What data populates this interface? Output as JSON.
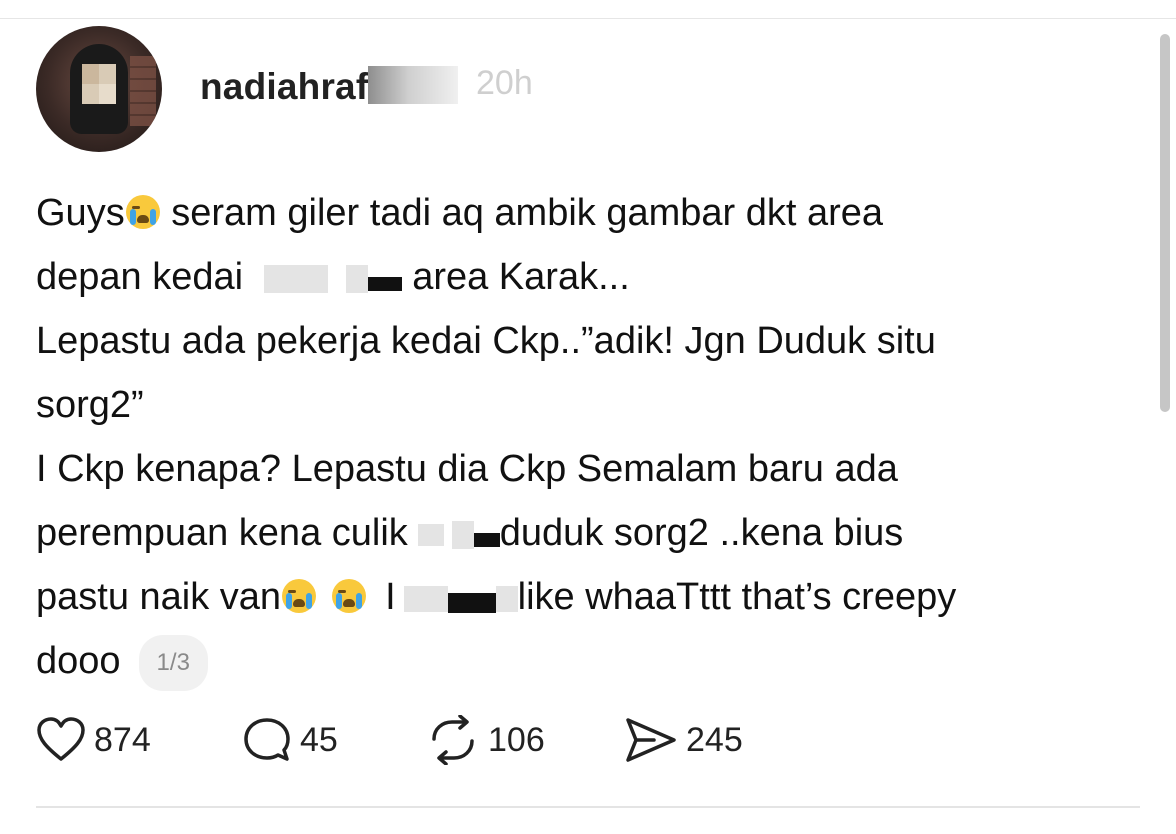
{
  "post": {
    "username_visible": "nadiahrafi",
    "timestamp_visible": "20h",
    "lines": {
      "l1a": "Guys",
      "l1b": " seram giler tadi aq ambik gambar dkt area",
      "l2a": "depan kedai ",
      "l2b": " area Karak...",
      "l3": "Lepastu ada pekerja kedai Ckp..”adik! Jgn Duduk situ",
      "l4": "sorg2”",
      "l5": "I Ckp kenapa? Lepastu dia Ckp Semalam baru ada",
      "l6a": "perempuan kena culik",
      "l6b": "duduk sorg2 ..kena bius",
      "l7a": "pastu naik van",
      "l7b": "I",
      "l7c": "like whaaTttt that’s creepy",
      "l8": "dooo"
    },
    "page_indicator": "1/3"
  },
  "stats": {
    "likes": "874",
    "comments": "45",
    "reposts": "106",
    "shares": "245"
  },
  "icons": {
    "emoji": "loudly-crying-face-emoji"
  },
  "colors": {
    "text": "#111111",
    "muted": "#8a8a8a",
    "pill_bg": "#f1f1f1"
  }
}
